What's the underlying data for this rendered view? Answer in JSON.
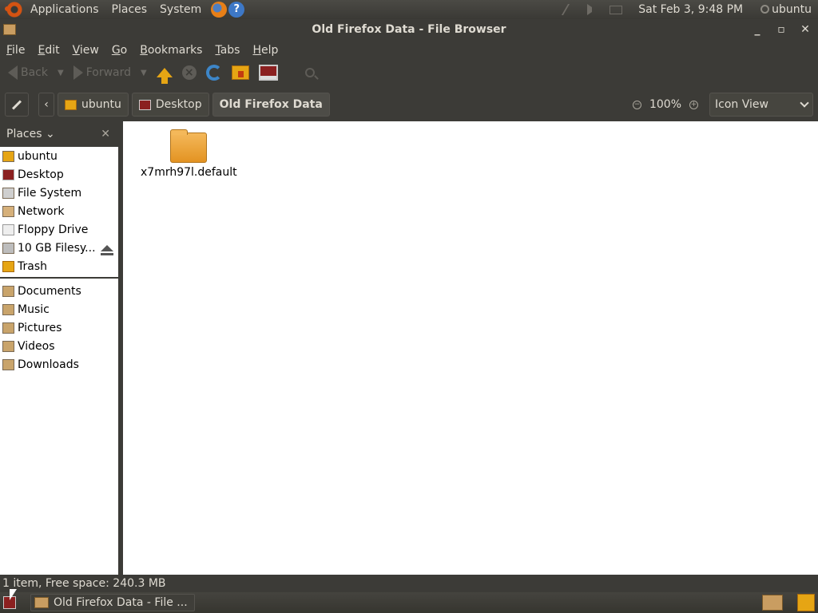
{
  "top_panel": {
    "menus": [
      "Applications",
      "Places",
      "System"
    ],
    "clock": "Sat Feb  3,  9:48 PM",
    "user": "ubuntu"
  },
  "window": {
    "title": "Old Firefox Data - File Browser",
    "controls": [
      "_",
      "▫",
      "✕"
    ]
  },
  "menubar": {
    "items": [
      {
        "u": "F",
        "rest": "ile"
      },
      {
        "u": "E",
        "rest": "dit"
      },
      {
        "u": "V",
        "rest": "iew"
      },
      {
        "u": "G",
        "rest": "o"
      },
      {
        "u": "B",
        "rest": "ookmarks"
      },
      {
        "u": "T",
        "rest": "abs"
      },
      {
        "u": "H",
        "rest": "elp"
      }
    ]
  },
  "toolbar": {
    "back_label": "Back",
    "forward_label": "Forward"
  },
  "location": {
    "nav_prev": "‹",
    "crumbs": [
      "ubuntu",
      "Desktop",
      "Old Firefox Data"
    ],
    "zoom": "100%",
    "zoom_out": "−",
    "zoom_in": "+",
    "view_mode": "Icon View"
  },
  "sidebar": {
    "header": "Places",
    "close": "✕",
    "devices": [
      {
        "label": "ubuntu",
        "icon": "home-icon"
      },
      {
        "label": "Desktop",
        "icon": "desktop-icon"
      },
      {
        "label": "File System",
        "icon": "filesystem-icon"
      },
      {
        "label": "Network",
        "icon": "network-icon"
      },
      {
        "label": "Floppy Drive",
        "icon": "floppy-icon"
      },
      {
        "label": "10 GB Filesy...",
        "icon": "harddisk-icon"
      },
      {
        "label": "Trash",
        "icon": "trash-icon"
      }
    ],
    "bookmarks": [
      {
        "label": "Documents",
        "icon": "folder-icon"
      },
      {
        "label": "Music",
        "icon": "folder-icon"
      },
      {
        "label": "Pictures",
        "icon": "folder-icon"
      },
      {
        "label": "Videos",
        "icon": "folder-icon"
      },
      {
        "label": "Downloads",
        "icon": "folder-icon"
      }
    ]
  },
  "main": {
    "files": [
      {
        "name": "x7mrh97l.default",
        "type": "folder"
      }
    ]
  },
  "statusbar": {
    "text": "1 item, Free space: 240.3 MB"
  },
  "taskbar": {
    "task_label": "Old Firefox Data - File ..."
  }
}
